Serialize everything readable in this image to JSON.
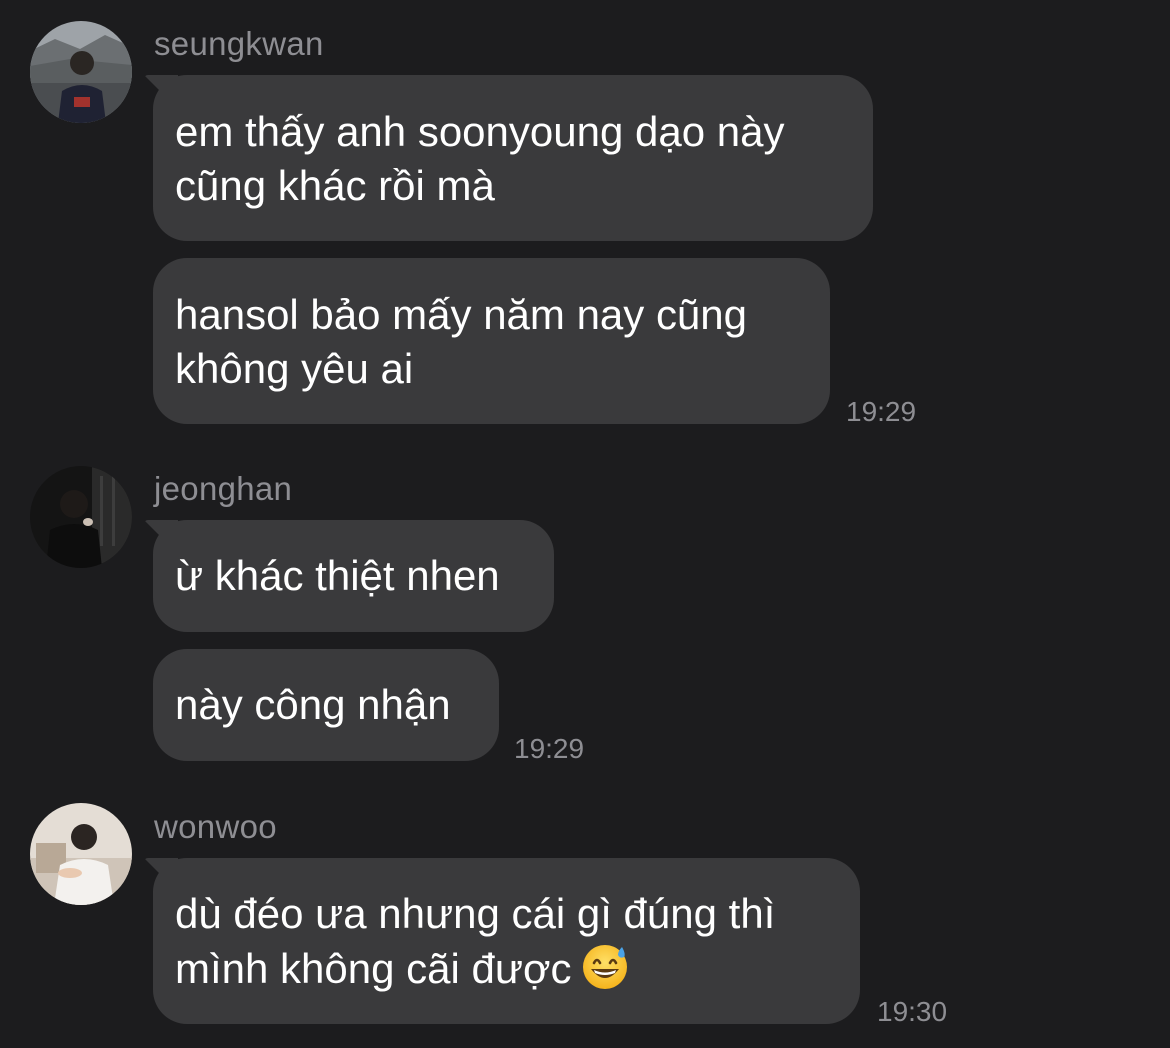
{
  "groups": [
    {
      "sender": "seungkwan",
      "messages": [
        {
          "lines": [
            "em thấy anh soonyoung dạo này",
            "cũng khác rồi mà"
          ]
        },
        {
          "lines": [
            "hansol bảo mấy năm nay cũng",
            "không yêu ai"
          ]
        }
      ],
      "time": "19:29"
    },
    {
      "sender": "jeonghan",
      "messages": [
        {
          "lines": [
            "ừ khác thiệt nhen"
          ]
        },
        {
          "lines": [
            "này công nhận"
          ]
        }
      ],
      "time": "19:29"
    },
    {
      "sender": "wonwoo",
      "messages": [
        {
          "lines": [
            "dù đéo ưa nhưng cái gì đúng thì",
            "mình không cãi được"
          ],
          "emoji": "grinning-sweat-emoji"
        }
      ],
      "time": "19:30"
    }
  ],
  "colors": {
    "background": "#1c1c1e",
    "bubble": "#3a3a3c",
    "text": "#ffffff",
    "meta": "#8e8e93"
  }
}
